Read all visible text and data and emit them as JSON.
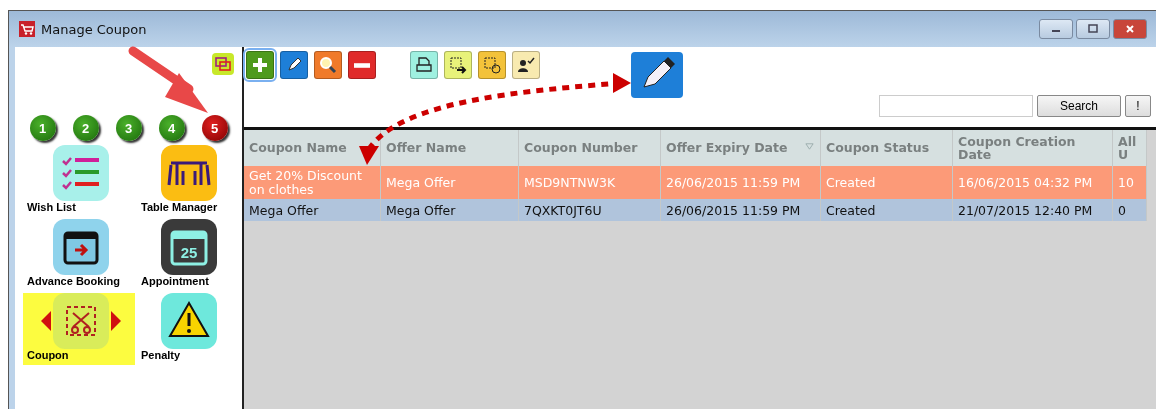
{
  "window": {
    "title": "Manage Coupon"
  },
  "steps": [
    {
      "label": "1",
      "selected": false
    },
    {
      "label": "2",
      "selected": false
    },
    {
      "label": "3",
      "selected": false
    },
    {
      "label": "4",
      "selected": false
    },
    {
      "label": "5",
      "selected": true
    }
  ],
  "sidebar": {
    "calendar_icon_text": "25",
    "items": [
      {
        "label": "Wish List",
        "kind": "wishlist",
        "selected": false
      },
      {
        "label": "Table Manager",
        "kind": "table",
        "selected": false
      },
      {
        "label": "Advance Booking",
        "kind": "booking",
        "selected": false
      },
      {
        "label": "Appointment",
        "kind": "appointment",
        "selected": false
      },
      {
        "label": "Coupon",
        "kind": "coupon",
        "selected": true
      },
      {
        "label": "Penalty",
        "kind": "penalty",
        "selected": false
      }
    ]
  },
  "toolbar": [
    {
      "kind": "add",
      "selected": true
    },
    {
      "kind": "edit",
      "selected": false
    },
    {
      "kind": "view",
      "selected": false
    },
    {
      "kind": "delete",
      "selected": false
    },
    {
      "kind": "print",
      "selected": false
    },
    {
      "kind": "export",
      "selected": false
    },
    {
      "kind": "schedule",
      "selected": false
    },
    {
      "kind": "approve",
      "selected": false
    }
  ],
  "search": {
    "button": "Search",
    "info_button": "!"
  },
  "table": {
    "columns": [
      "Coupon Name",
      "Offer Name",
      "Coupon Number",
      "Offer Expiry Date",
      "Coupon Status",
      "Coupon Creation Date",
      "All U"
    ],
    "rows": [
      {
        "cells": [
          "Get 20% Discount on clothes",
          "Mega Offer",
          "MSD9NTNW3K",
          "26/06/2015 11:59 PM",
          "Created",
          "16/06/2015 04:32 PM",
          "10"
        ],
        "highlighted": true,
        "selected": false
      },
      {
        "cells": [
          "Mega Offer",
          "Mega Offer",
          "7QXKT0JT6U",
          "26/06/2015 11:59 PM",
          "Created",
          "21/07/2015 12:40 PM",
          "0"
        ],
        "highlighted": false,
        "selected": true
      }
    ]
  }
}
